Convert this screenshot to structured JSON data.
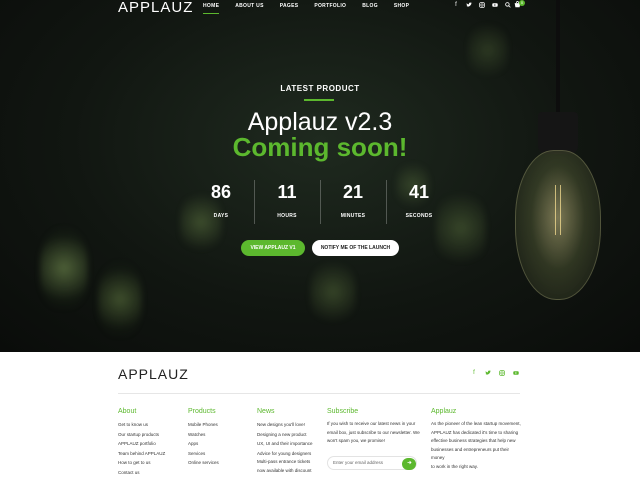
{
  "brand": {
    "logo": "APPLAUZ",
    "accent": "#5cb82e"
  },
  "nav": {
    "items": [
      {
        "label": "HOME",
        "active": true
      },
      {
        "label": "ABOUT US"
      },
      {
        "label": "PAGES"
      },
      {
        "label": "PORTFOLIO"
      },
      {
        "label": "BLOG"
      },
      {
        "label": "SHOP"
      }
    ],
    "icons": [
      "facebook-icon",
      "twitter-icon",
      "instagram-icon",
      "youtube-icon",
      "search-icon"
    ],
    "cart_count": "0"
  },
  "hero": {
    "eyebrow": "LATEST PRODUCT",
    "headline": "Applauz v2.3",
    "subheadline": "Coming soon!",
    "countdown": [
      {
        "value": "86",
        "label": "DAYS"
      },
      {
        "value": "11",
        "label": "HOURS"
      },
      {
        "value": "21",
        "label": "MINUTES"
      },
      {
        "value": "41",
        "label": "SECONDS"
      }
    ],
    "primary_button": "VIEW APPLAUZ V1",
    "secondary_button": "NOTIFY ME OF THE LAUNCH"
  },
  "footer": {
    "logo": "APPLAUZ",
    "social": [
      "facebook-icon",
      "twitter-icon",
      "instagram-icon",
      "youtube-icon"
    ],
    "about": {
      "title": "About",
      "links": [
        "Get to know us",
        "Our startup products",
        "APPLAUZ portfolio",
        "Team behind APPLAUZ",
        "How to get to us",
        "Contact us"
      ]
    },
    "products": {
      "title": "Products",
      "links": [
        "Mobile Phones",
        "Watches",
        "Apps",
        "Services",
        "Online services"
      ]
    },
    "news": {
      "title": "News",
      "links": [
        "New designs you'll love!",
        "Designing a new product",
        "UX, UI and their importance",
        "Advice for young designers",
        "Multi-pass entrance tickets",
        "now available with discount"
      ]
    },
    "subscribe": {
      "title": "Subscribe",
      "text_lines": [
        "If you wish to receive our latest news in your",
        "email box, just subscribe to our newsletter. We",
        "won't spam you, we promise!"
      ],
      "placeholder": "Enter your email address",
      "button_icon": "arrow-right-icon"
    },
    "applauz": {
      "title": "Applauz",
      "text_lines": [
        "As the pioneer of the lean startup movement,",
        "APPLAUZ has dedicated it's time to sharing",
        "effective business strategies that help new",
        "businesses and entrepreneurs put their money",
        "to work in the right way."
      ]
    }
  }
}
